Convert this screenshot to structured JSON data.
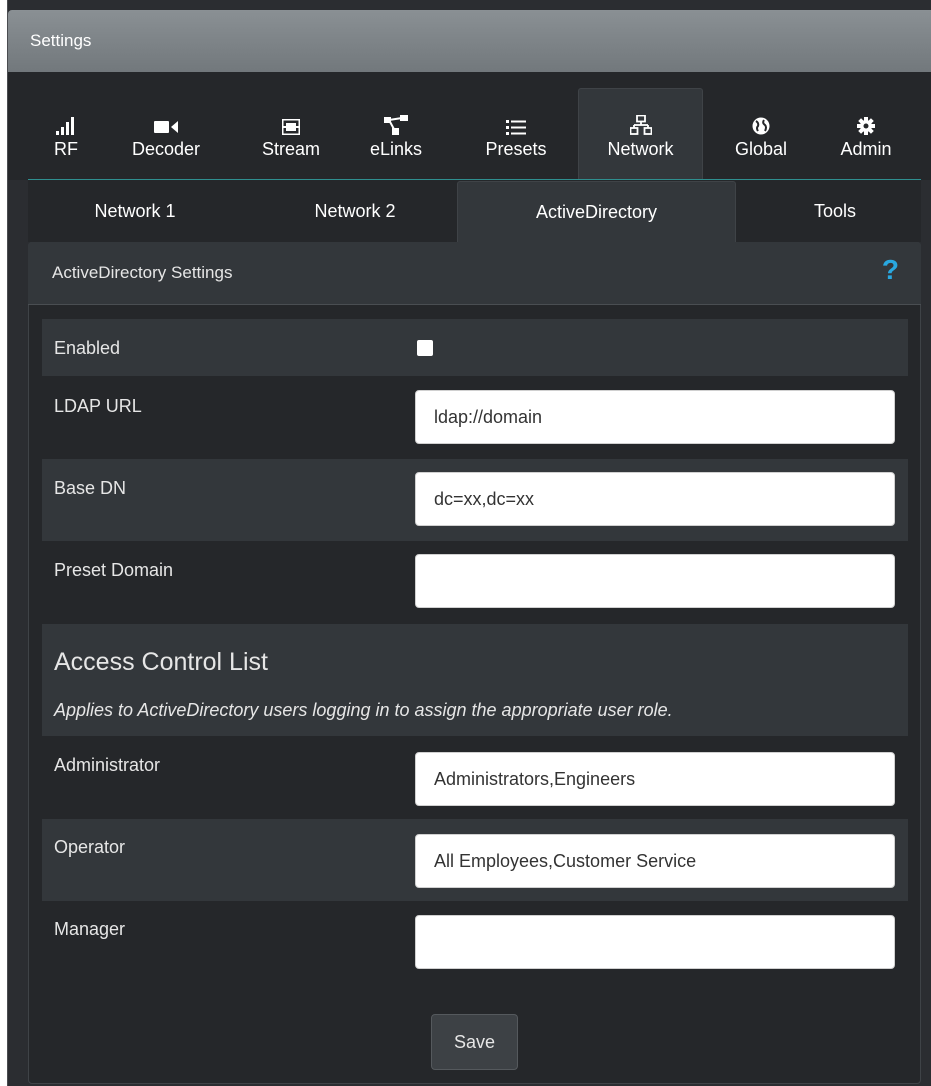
{
  "window": {
    "title": "Settings"
  },
  "main_tabs": [
    {
      "label": "RF",
      "icon": "signal-icon"
    },
    {
      "label": "Decoder",
      "icon": "video-camera-icon"
    },
    {
      "label": "Stream",
      "icon": "film-icon"
    },
    {
      "label": "eLinks",
      "icon": "link-nodes-icon"
    },
    {
      "label": "Presets",
      "icon": "list-icon"
    },
    {
      "label": "Network",
      "icon": "network-icon",
      "active": true
    },
    {
      "label": "Global",
      "icon": "globe-icon"
    },
    {
      "label": "Admin",
      "icon": "gear-icon"
    }
  ],
  "sub_tabs": [
    {
      "label": "Network 1"
    },
    {
      "label": "Network 2"
    },
    {
      "label": "ActiveDirectory",
      "active": true
    },
    {
      "label": "Tools"
    }
  ],
  "panel": {
    "title": "ActiveDirectory Settings",
    "help": "?",
    "enabled_label": "Enabled",
    "enabled_checked": false,
    "ldap_url_label": "LDAP URL",
    "ldap_url_value": "ldap://domain",
    "base_dn_label": "Base DN",
    "base_dn_value": "dc=xx,dc=xx",
    "preset_domain_label": "Preset Domain",
    "preset_domain_value": ""
  },
  "acl": {
    "title": "Access Control List",
    "description": "Applies to ActiveDirectory users logging in to assign the appropriate user role.",
    "administrator_label": "Administrator",
    "administrator_value": "Administrators,Engineers",
    "operator_label": "Operator",
    "operator_value": "All Employees,Customer Service",
    "manager_label": "Manager",
    "manager_value": ""
  },
  "actions": {
    "save_label": "Save"
  },
  "colors": {
    "accent": "#29a8e0",
    "tab_underline": "#2f8f8f",
    "panel_bg": "#25272a",
    "row_shade": "#33373b"
  }
}
